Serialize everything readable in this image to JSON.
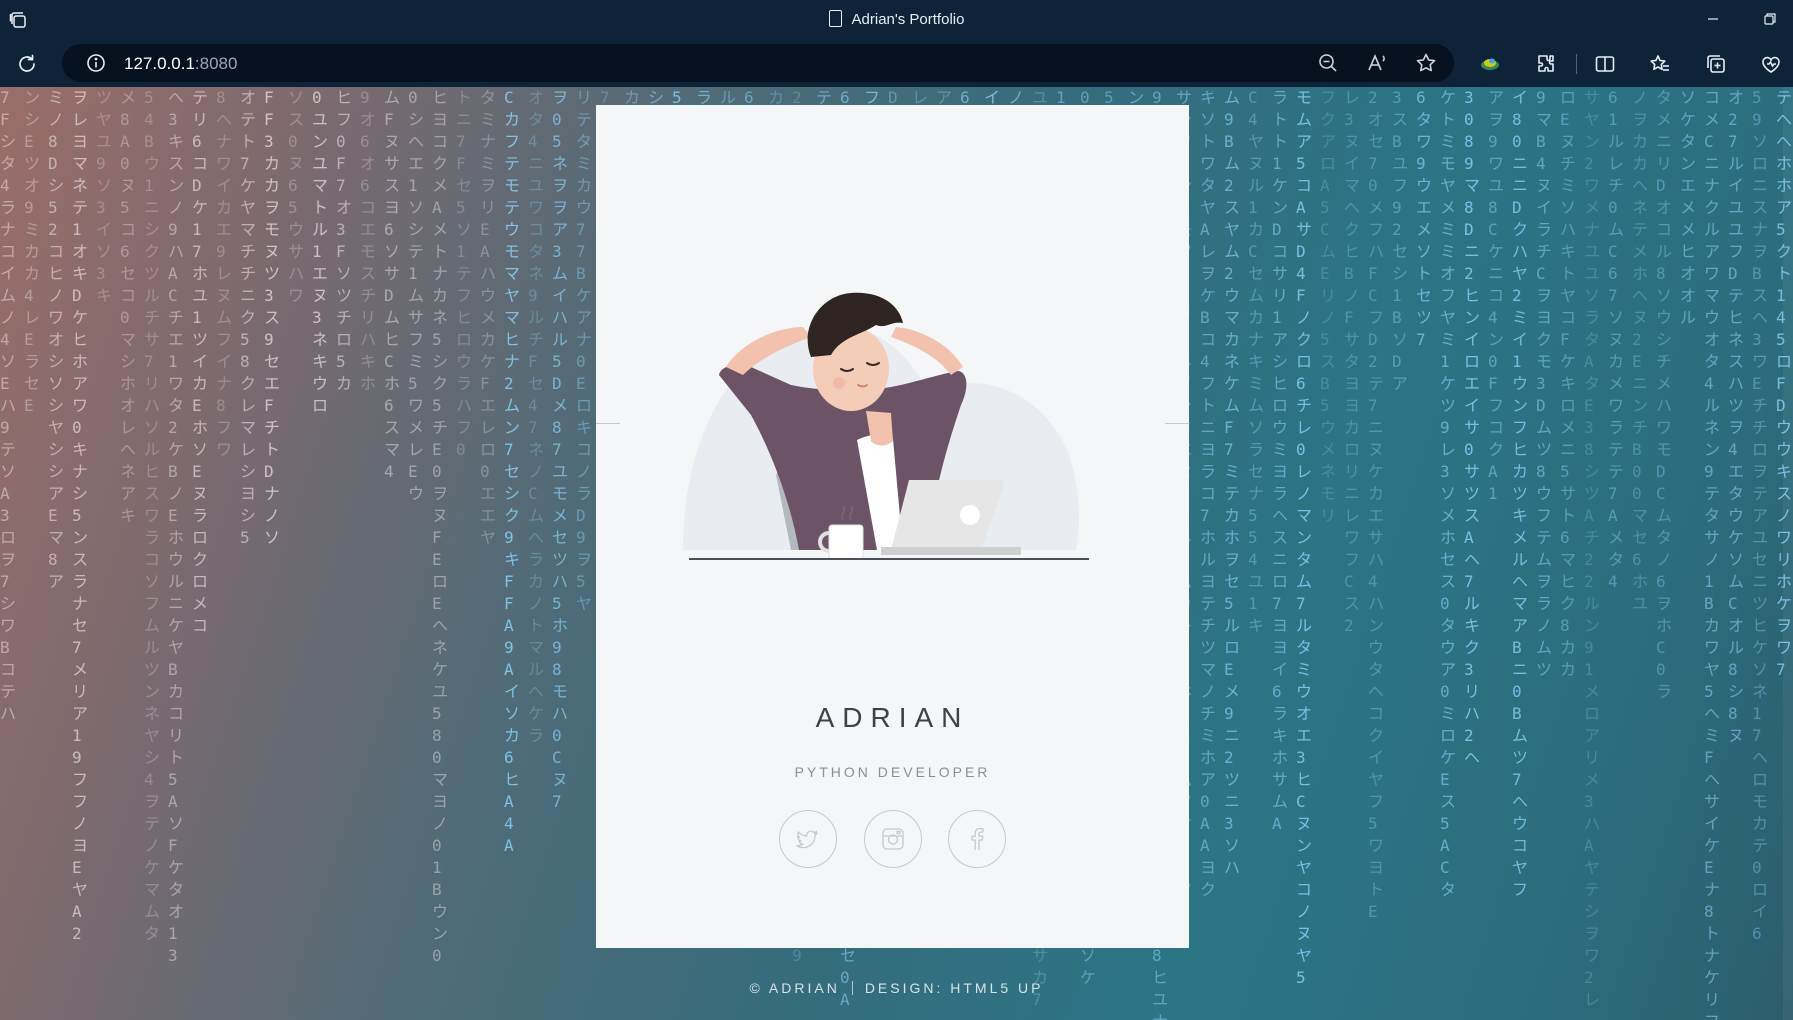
{
  "window": {
    "title": "Adrian's Portfolio",
    "app_icon": "tabs-icon",
    "controls": [
      "minimize-icon",
      "restore-icon"
    ]
  },
  "toolbar": {
    "url_host": "127.0.0.1",
    "url_port": ":8080",
    "left_icons": [
      "refresh-icon",
      "site-info-icon"
    ],
    "right_icons": [
      "zoom-out-icon",
      "read-aloud-icon",
      "favorite-star-icon",
      "profile-icon",
      "extensions-icon",
      "split-screen-icon",
      "favorites-icon",
      "collections-icon",
      "browser-essentials-icon"
    ]
  },
  "page": {
    "name": "ADRIAN",
    "role": "PYTHON DEVELOPER",
    "social_icons": [
      "twitter-icon",
      "instagram-icon",
      "facebook-icon"
    ],
    "footer_copyright": "© ADRIAN",
    "footer_design": "DESIGN: HTML5 UP"
  },
  "colors": {
    "card_bg": "#f5f6f7",
    "matrix_glyph": "#8ed8ff",
    "browser_chrome": "#0e2238"
  }
}
